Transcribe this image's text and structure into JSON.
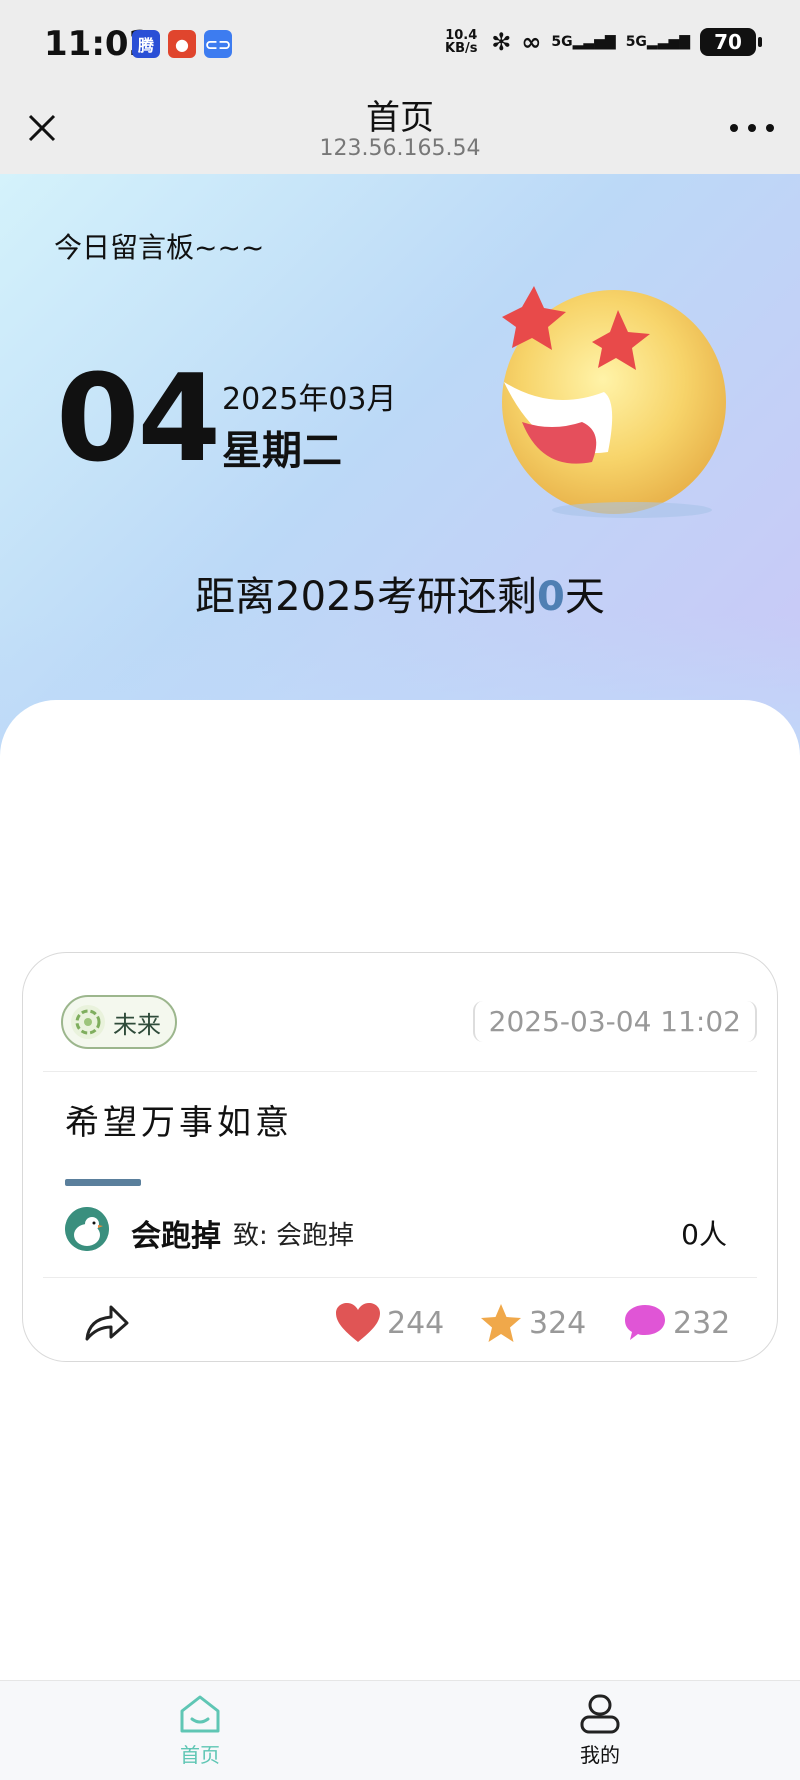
{
  "status_bar": {
    "time": "11:02",
    "net_speed": "10.4 KB/s",
    "signal_1": "5G",
    "signal_2": "5G",
    "battery": "70",
    "colors": {
      "app1": "#2a4fd6",
      "app2": "#e0452d",
      "app3": "#3d7cf0"
    }
  },
  "title_bar": {
    "title": "首页",
    "url": "123.56.165.54"
  },
  "hero": {
    "greeting": "今日留言板~~~",
    "day": "04",
    "year_month": "2025年03月",
    "weekday": "星期二",
    "countdown_prefix": "距离2025考研还剩",
    "countdown_days": "0",
    "countdown_suffix": "天"
  },
  "card": {
    "tag": "未来",
    "date": "2025-03-04 11:02",
    "message": "希望万事如意",
    "author": "会跑掉",
    "to_label": "致: 会跑掉",
    "people_count": "0人",
    "likes": "244",
    "stars": "324",
    "comments": "232",
    "colors": {
      "heart": "#e05555",
      "star": "#f0a84a",
      "comment": "#e055d6",
      "accent": "#5a7f9c"
    }
  },
  "bottom_nav": {
    "items": [
      {
        "label": "首页",
        "icon": "home-icon",
        "active": true
      },
      {
        "label": "我的",
        "icon": "user-icon",
        "active": false
      }
    ],
    "active_color": "#5fc6b4"
  }
}
